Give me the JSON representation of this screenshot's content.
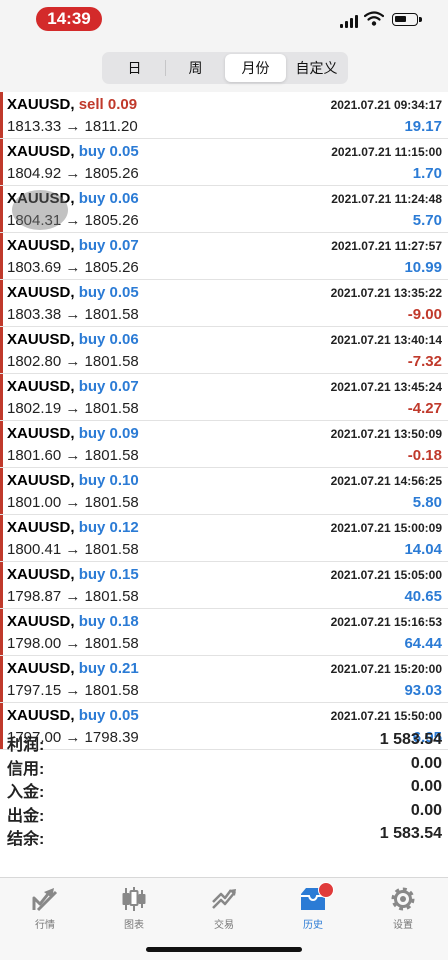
{
  "status": {
    "time": "14:39"
  },
  "tabs": [
    {
      "label": "日"
    },
    {
      "label": "周"
    },
    {
      "label": "月份",
      "active": true
    },
    {
      "label": "自定义"
    }
  ],
  "deals": [
    {
      "symbol": "XAUUSD,",
      "action": "sell 0.09",
      "side": "sell",
      "prices": "1813.33 → 1811.20",
      "datetime": "2021.07.21 09:34:17",
      "profit": "19.17"
    },
    {
      "symbol": "XAUUSD,",
      "action": "buy 0.05",
      "side": "buy",
      "prices": "1804.92 → 1805.26",
      "datetime": "2021.07.21 11:15:00",
      "profit": "1.70"
    },
    {
      "symbol": "XAUUSD,",
      "action": "buy 0.06",
      "side": "buy",
      "prices": "1804.31 → 1805.26",
      "datetime": "2021.07.21 11:24:48",
      "profit": "5.70"
    },
    {
      "symbol": "XAUUSD,",
      "action": "buy 0.07",
      "side": "buy",
      "prices": "1803.69 → 1805.26",
      "datetime": "2021.07.21 11:27:57",
      "profit": "10.99"
    },
    {
      "symbol": "XAUUSD,",
      "action": "buy 0.05",
      "side": "buy",
      "prices": "1803.38 → 1801.58",
      "datetime": "2021.07.21 13:35:22",
      "profit": "-9.00"
    },
    {
      "symbol": "XAUUSD,",
      "action": "buy 0.06",
      "side": "buy",
      "prices": "1802.80 → 1801.58",
      "datetime": "2021.07.21 13:40:14",
      "profit": "-7.32"
    },
    {
      "symbol": "XAUUSD,",
      "action": "buy 0.07",
      "side": "buy",
      "prices": "1802.19 → 1801.58",
      "datetime": "2021.07.21 13:45:24",
      "profit": "-4.27"
    },
    {
      "symbol": "XAUUSD,",
      "action": "buy 0.09",
      "side": "buy",
      "prices": "1801.60 → 1801.58",
      "datetime": "2021.07.21 13:50:09",
      "profit": "-0.18"
    },
    {
      "symbol": "XAUUSD,",
      "action": "buy 0.10",
      "side": "buy",
      "prices": "1801.00 → 1801.58",
      "datetime": "2021.07.21 14:56:25",
      "profit": "5.80"
    },
    {
      "symbol": "XAUUSD,",
      "action": "buy 0.12",
      "side": "buy",
      "prices": "1800.41 → 1801.58",
      "datetime": "2021.07.21 15:00:09",
      "profit": "14.04"
    },
    {
      "symbol": "XAUUSD,",
      "action": "buy 0.15",
      "side": "buy",
      "prices": "1798.87 → 1801.58",
      "datetime": "2021.07.21 15:05:00",
      "profit": "40.65"
    },
    {
      "symbol": "XAUUSD,",
      "action": "buy 0.18",
      "side": "buy",
      "prices": "1798.00 → 1801.58",
      "datetime": "2021.07.21 15:16:53",
      "profit": "64.44"
    },
    {
      "symbol": "XAUUSD,",
      "action": "buy 0.21",
      "side": "buy",
      "prices": "1797.15 → 1801.58",
      "datetime": "2021.07.21 15:20:00",
      "profit": "93.03"
    },
    {
      "symbol": "XAUUSD,",
      "action": "buy 0.05",
      "side": "buy",
      "prices": "1797.00 → 1798.39",
      "datetime": "2021.07.21 15:50:00",
      "profit": "6.95"
    }
  ],
  "summary": [
    {
      "label": "利润:",
      "value": "1 583.54"
    },
    {
      "label": "信用:",
      "value": "0.00"
    },
    {
      "label": "入金:",
      "value": "0.00"
    },
    {
      "label": "出金:",
      "value": "0.00"
    },
    {
      "label": "结余:",
      "value": "1 583.54"
    }
  ],
  "tabbar": [
    {
      "label": "行情",
      "icon": "quotes-icon"
    },
    {
      "label": "图表",
      "icon": "chart-icon"
    },
    {
      "label": "交易",
      "icon": "trade-icon"
    },
    {
      "label": "历史",
      "icon": "history-icon",
      "active": true
    },
    {
      "label": "设置",
      "icon": "settings-icon"
    }
  ],
  "colors": {
    "buy": "#2b7bd5",
    "sell": "#c0392b",
    "accent": "#2b7bd5",
    "time_pill": "#d32a2a"
  }
}
